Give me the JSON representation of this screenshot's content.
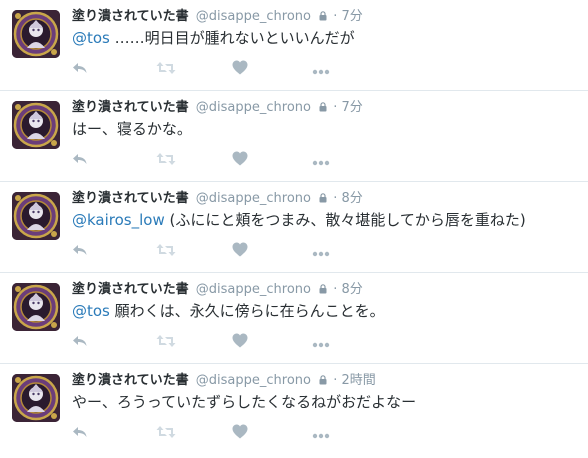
{
  "tweets": [
    {
      "name": "塗り潰されていた書",
      "handle": "@disappe_chrono",
      "time": "7分",
      "mention": "@tos",
      "text": " ……明日目が腫れないといいんだが"
    },
    {
      "name": "塗り潰されていた書",
      "handle": "@disappe_chrono",
      "time": "7分",
      "mention": "",
      "text": "はー、寝るかな。"
    },
    {
      "name": "塗り潰されていた書",
      "handle": "@disappe_chrono",
      "time": "8分",
      "mention": "@kairos_low",
      "text": " (ふににと頬をつまみ、散々堪能してから唇を重ねた)"
    },
    {
      "name": "塗り潰されていた書",
      "handle": "@disappe_chrono",
      "time": "8分",
      "mention": "@tos",
      "text": " 願わくは、永久に傍らに在らんことを。"
    },
    {
      "name": "塗り潰されていた書",
      "handle": "@disappe_chrono",
      "time": "2時間",
      "mention": "",
      "text": "やー、ろうっていたずらしたくなるねがおだよなー"
    }
  ],
  "icons": {
    "reply": "reply-icon",
    "retweet": "retweet-icon",
    "like": "heart-icon",
    "more": "more-icon",
    "protected": "lock-icon"
  },
  "colors": {
    "text": "#292f33",
    "muted": "#8899a6",
    "link": "#2b7bb9",
    "icon": "#aab8c2",
    "divider": "#e1e8ed"
  }
}
